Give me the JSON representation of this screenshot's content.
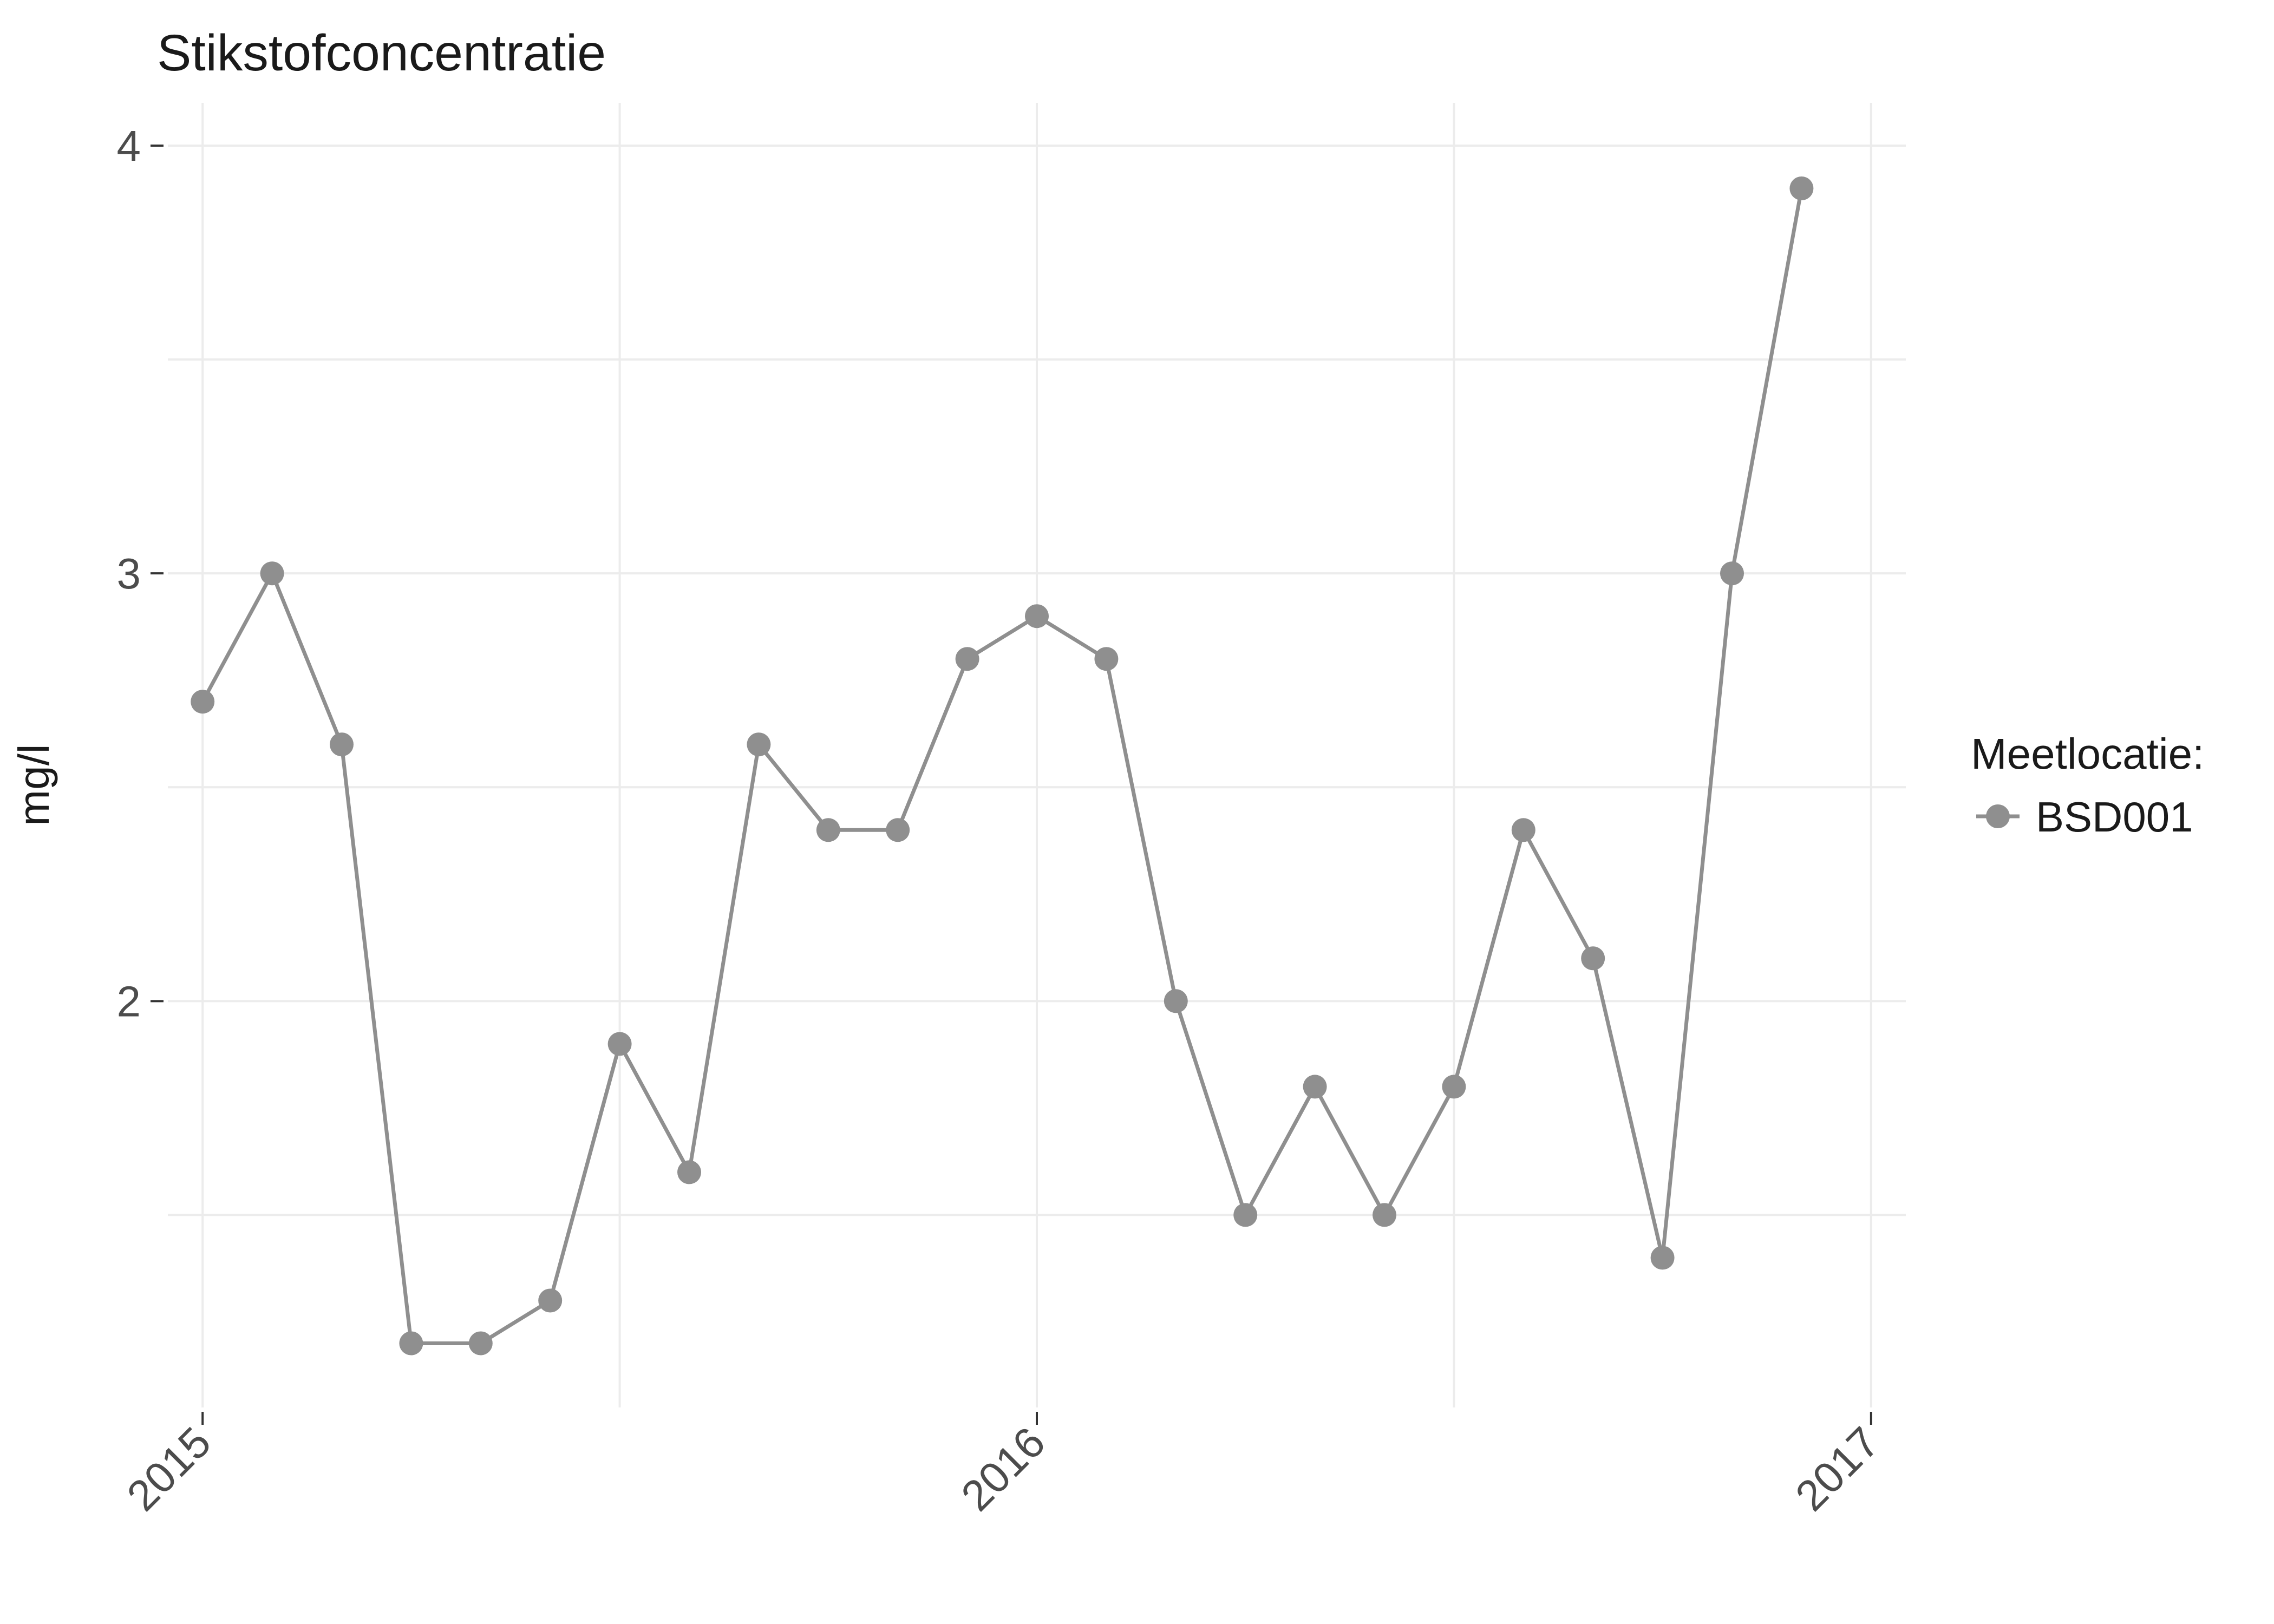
{
  "chart_data": {
    "type": "line",
    "title": "Stikstofconcentratie",
    "ylabel": "mg/l",
    "xlabel": "",
    "ylim": [
      1.05,
      4.1
    ],
    "xlim": [
      -0.5,
      24.5
    ],
    "x_ticks": [
      {
        "x": 0,
        "label": "2015"
      },
      {
        "x": 12,
        "label": "2016"
      },
      {
        "x": 24,
        "label": "2017"
      }
    ],
    "y_ticks": [
      2,
      3,
      4
    ],
    "legend_title": "Meetlocatie:",
    "series": [
      {
        "name": "BSD001",
        "color": "#8F8F8F",
        "x": [
          0,
          1,
          2,
          3,
          4,
          5,
          6,
          7,
          8,
          9,
          10,
          11,
          12,
          13,
          14,
          15,
          16,
          17,
          18,
          19,
          20,
          21,
          22,
          23,
          24
        ],
        "values": [
          2.7,
          3.0,
          2.6,
          1.2,
          1.2,
          1.3,
          1.9,
          1.6,
          2.6,
          2.4,
          2.4,
          2.8,
          2.9,
          2.8,
          2.0,
          1.5,
          1.8,
          1.5,
          1.8,
          2.4,
          2.1,
          1.4,
          3.0,
          3.9,
          null
        ]
      }
    ]
  }
}
